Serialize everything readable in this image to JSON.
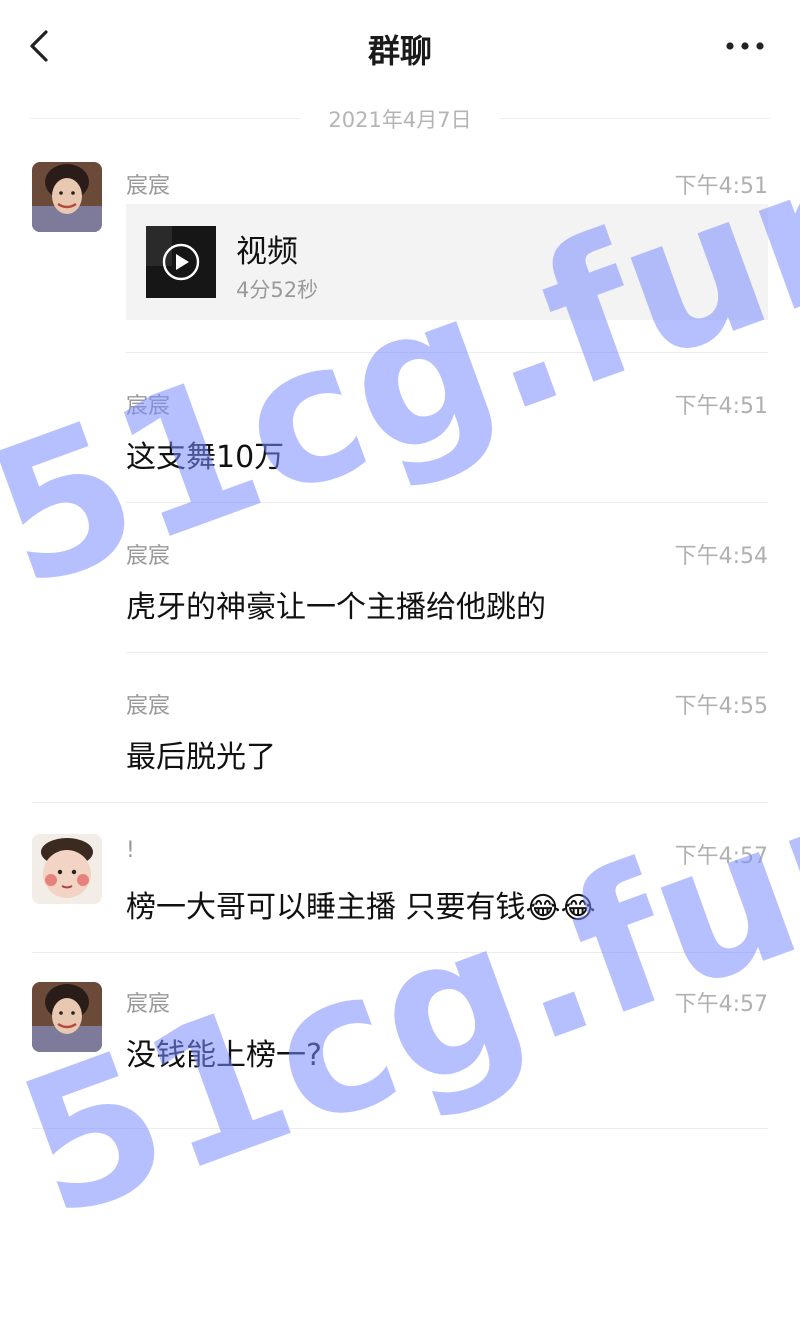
{
  "header": {
    "back_icon": "chevron-left-icon",
    "title": "群聊",
    "more_icon": "more-horizontal-icon"
  },
  "date_separator": "2021年4月7日",
  "messages": [
    {
      "sender": "宸宸",
      "time": "下午4:51",
      "video": {
        "title": "视频",
        "duration": "4分52秒",
        "icon": "play-icon"
      }
    },
    {
      "sender": "宸宸",
      "time": "下午4:51",
      "text": "这支舞10万"
    },
    {
      "sender": "宸宸",
      "time": "下午4:54",
      "text": "虎牙的神豪让一个主播给他跳的"
    },
    {
      "sender": "宸宸",
      "time": "下午4:55",
      "text": "最后脱光了"
    },
    {
      "sender": "!",
      "time": "下午4:57",
      "text": "榜一大哥可以睡主播 只要有钱",
      "emoji": "😂😂"
    },
    {
      "sender": "宸宸",
      "time": "下午4:57",
      "text": "没钱能上榜一?"
    }
  ],
  "watermark": {
    "text_1": "51cg.fun",
    "text_2": "51cg.fun",
    "color": "#7a8cff"
  }
}
